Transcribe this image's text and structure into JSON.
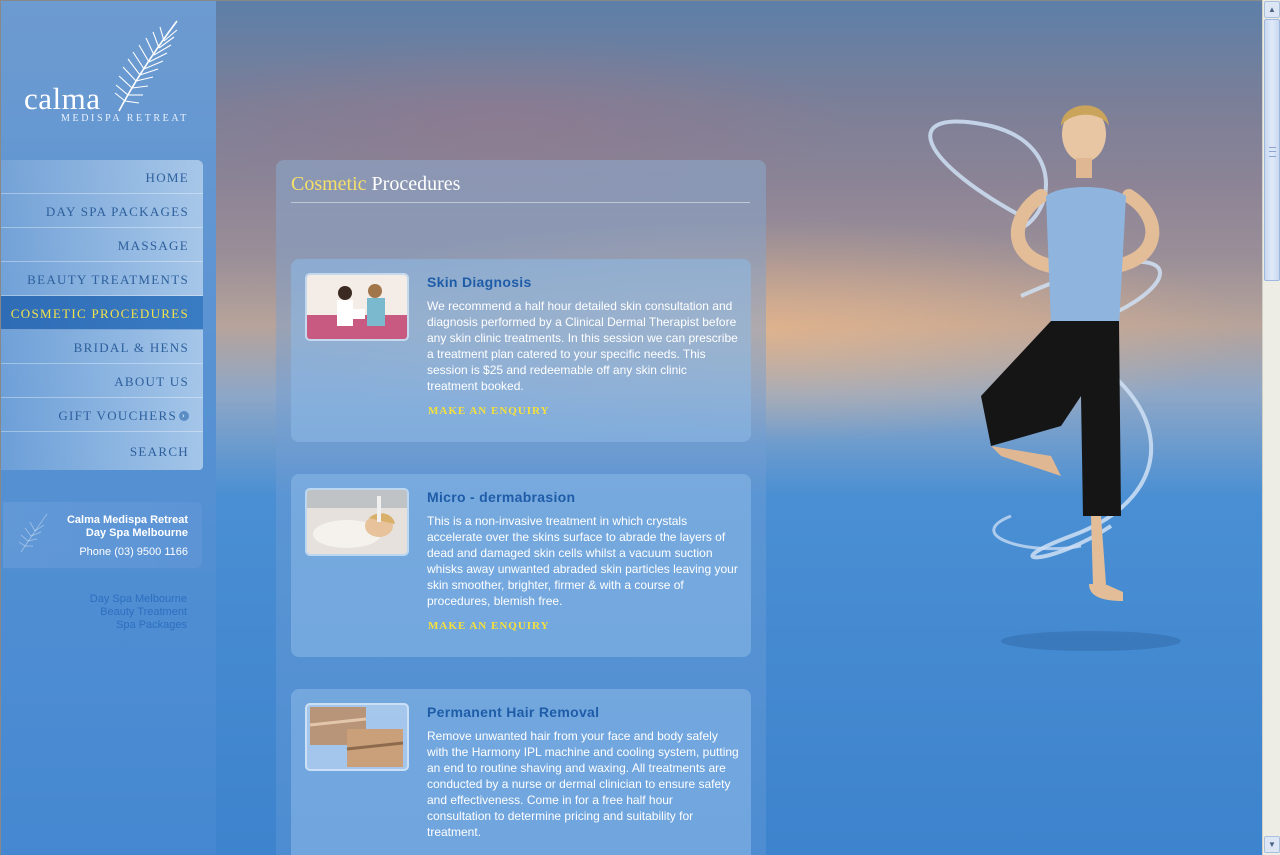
{
  "logo": {
    "wordmark": "calma",
    "subtitle": "MEDISPA RETREAT"
  },
  "nav": {
    "items": [
      {
        "label": "HOME"
      },
      {
        "label": "DAY SPA PACKAGES"
      },
      {
        "label": "MASSAGE"
      },
      {
        "label": "BEAUTY TREATMENTS"
      },
      {
        "label": "COSMETIC PROCEDURES",
        "active": true
      },
      {
        "label": "BRIDAL & HENS"
      },
      {
        "label": "ABOUT US"
      },
      {
        "label": "GIFT VOUCHERS"
      },
      {
        "label": "SEARCH"
      }
    ]
  },
  "contact": {
    "name": "Calma Medispa Retreat",
    "tagline": "Day Spa Melbourne",
    "phone": "Phone (03) 9500 1166"
  },
  "footer_links": [
    "Day Spa Melbourne",
    "Beauty Treatment",
    "Spa Packages"
  ],
  "page": {
    "title_accent": "Cosmetic",
    "title_rest": "Procedures"
  },
  "cards": [
    {
      "title": "Skin Diagnosis",
      "body": "We recommend a half hour detailed skin consultation and diagnosis performed by a Clinical Dermal Therapist before any skin clinic treatments. In this session we can prescribe a treatment plan catered to your specific needs. This session is $25 and redeemable off any skin clinic treatment booked.",
      "link": "MAKE AN ENQUIRY"
    },
    {
      "title": "Micro - dermabrasion",
      "body": "This is a non-invasive treatment in which crystals accelerate over the skins surface to abrade the layers of dead and damaged skin cells whilst a vacuum suction whisks away unwanted abraded skin particles leaving your skin smoother, brighter, firmer & with a course of procedures, blemish free.",
      "link": "MAKE AN ENQUIRY"
    },
    {
      "title": "Permanent Hair Removal",
      "body": "Remove unwanted hair from your face and body safely with the Harmony IPL machine and cooling system, putting an end to routine shaving and waxing. All treatments are conducted by a nurse or dermal clinician to ensure safety and effectiveness. Come in for a free half hour consultation to determine pricing and suitability for treatment."
    }
  ],
  "colors": {
    "accent_yellow": "#f6e06a",
    "nav_text": "#2d5f9c",
    "card_title": "#1f5ca8"
  }
}
